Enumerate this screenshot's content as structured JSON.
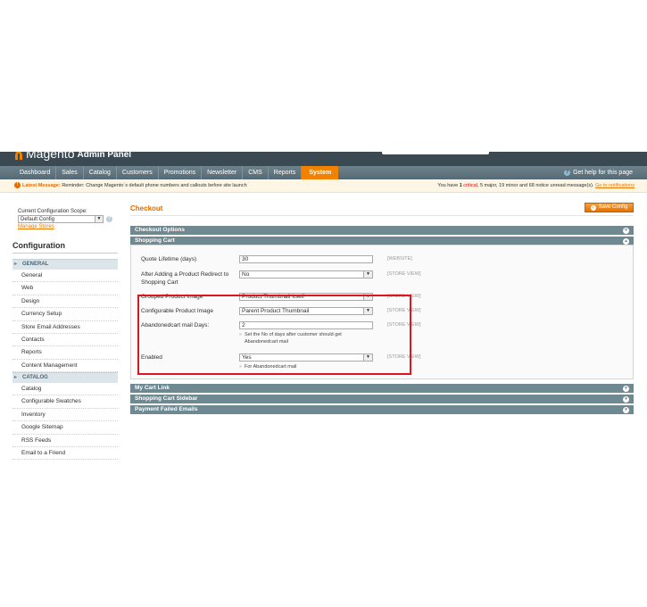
{
  "header": {
    "brand": "Magento",
    "subtitle": "Admin Panel"
  },
  "nav": {
    "items": [
      "Dashboard",
      "Sales",
      "Catalog",
      "Customers",
      "Promotions",
      "Newsletter",
      "CMS",
      "Reports",
      "System"
    ],
    "active": "System",
    "help": "Get help for this page"
  },
  "message": {
    "label": "Latest Message:",
    "text": "Reminder: Change Magento`s default phone numbers and callouts before site launch",
    "right_prefix": "You have",
    "critical_count": "1",
    "critical_label": "critical",
    "rest": ", 5 major, 19 minor and 68 notice unread message(s).",
    "link": "Go to notifications"
  },
  "sidebar": {
    "scope_label": "Current Configuration Scope:",
    "scope_value": "Default Config",
    "manage_stores": "Manage Stores",
    "title": "Configuration",
    "groups": [
      {
        "name": "GENERAL",
        "items": [
          "General",
          "Web",
          "Design",
          "Currency Setup",
          "Store Email Addresses",
          "Contacts",
          "Reports",
          "Content Management"
        ]
      },
      {
        "name": "CATALOG",
        "items": [
          "Catalog",
          "Configurable Swatches",
          "Inventory",
          "Google Sitemap",
          "RSS Feeds",
          "Email to a Friend"
        ]
      }
    ]
  },
  "main": {
    "title": "Checkout",
    "save_button": "Save Config",
    "sections": {
      "checkout_options": "Checkout Options",
      "shopping_cart": "Shopping Cart",
      "my_cart_link": "My Cart Link",
      "shopping_cart_sidebar": "Shopping Cart Sidebar",
      "payment_failed_emails": "Payment Failed Emails"
    },
    "fields": {
      "quote_lifetime": {
        "label": "Quote Lifetime (days)",
        "value": "30",
        "scope": "[WEBSITE]"
      },
      "redirect": {
        "label": "After Adding a Product Redirect to Shopping Cart",
        "value": "No",
        "scope": "[STORE VIEW]"
      },
      "grouped_image": {
        "label": "Grouped Product Image",
        "value": "Product Thumbnail Itself",
        "scope": "[STORE VIEW]"
      },
      "configurable_image": {
        "label": "Configurable Product Image",
        "value": "Parent Product Thumbnail",
        "scope": "[STORE VIEW]"
      },
      "abandoned_days": {
        "label": "Abandonedcart mail Days:",
        "value": "2",
        "scope": "[STORE VIEW]",
        "note": "Set the No of days after customer should get Abandonedcart mail"
      },
      "enabled": {
        "label": "Enabled",
        "value": "Yes",
        "scope": "[STORE VIEW]",
        "note": "For Abandonedcart mail"
      }
    }
  },
  "colors": {
    "accent": "#f18200",
    "header_bg": "#3b4a52",
    "section_bg": "#6f8992",
    "highlight": "#e0141e"
  }
}
